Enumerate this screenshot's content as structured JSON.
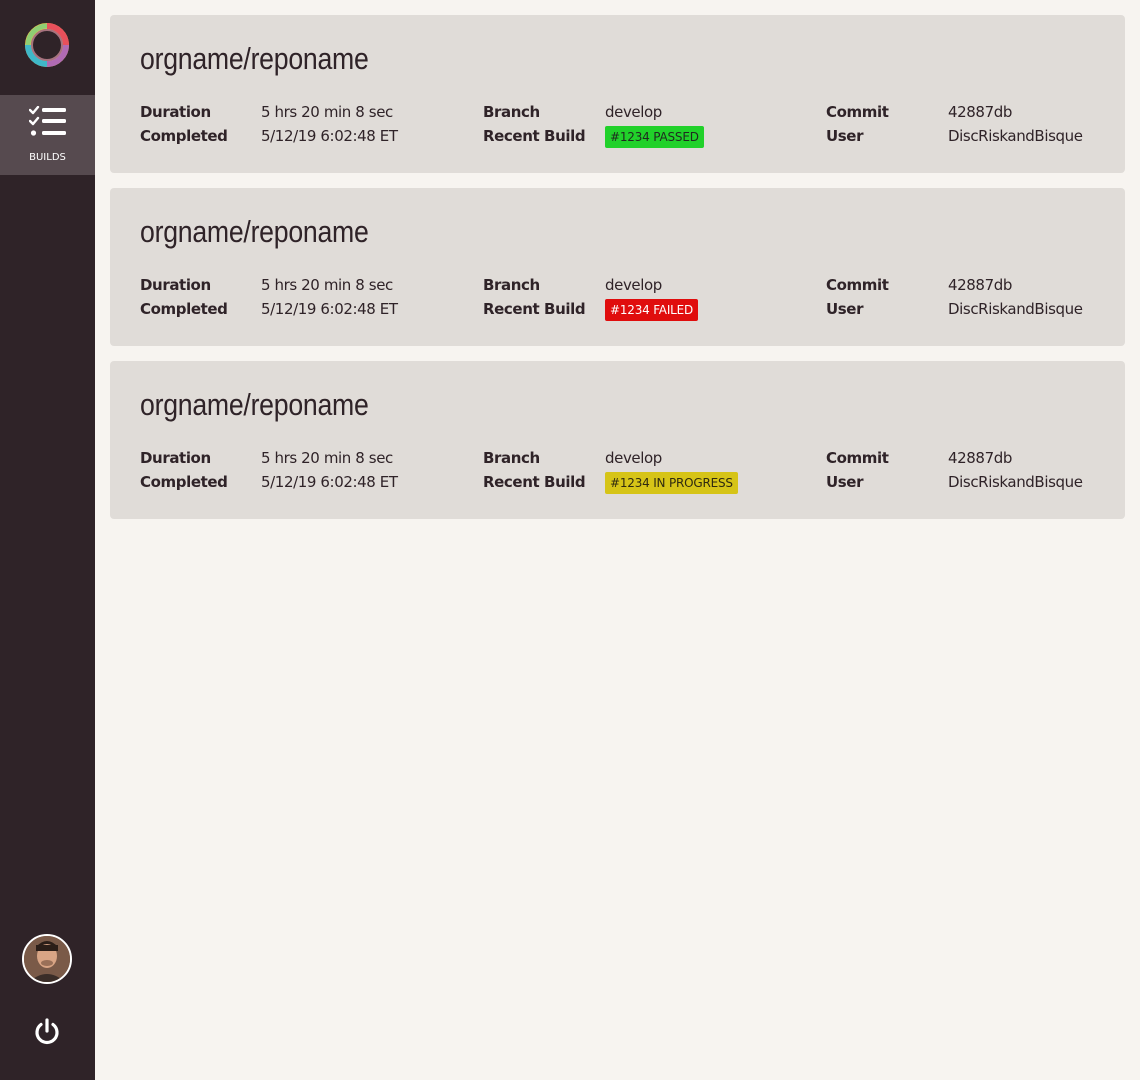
{
  "sidebar": {
    "nav_builds_label": "BUILDS"
  },
  "icons": {
    "logo": "ring-logo-icon",
    "builds": "checklist-icon",
    "avatar": "user-avatar",
    "power": "power-icon"
  },
  "colors": {
    "sidebar_bg": "#2f2328",
    "sidebar_active": "#564a4f",
    "card_bg": "#e0dcd8",
    "page_bg": "#f7f4f0",
    "passed": "#21d12a",
    "failed": "#e00d0d",
    "in_progress": "#d6c417"
  },
  "labels": {
    "duration": "Duration",
    "completed": "Completed",
    "branch": "Branch",
    "recent_build": "Recent Build",
    "commit": "Commit",
    "user": "User"
  },
  "builds": [
    {
      "repo": "orgname/reponame",
      "duration": "5 hrs 20 min 8 sec",
      "completed": "5/12/19 6:02:48 ET",
      "branch": "develop",
      "recent_build": "#1234 PASSED",
      "status": "passed",
      "commit": "42887db",
      "user": "DiscRiskandBisque"
    },
    {
      "repo": "orgname/reponame",
      "duration": "5 hrs 20 min 8 sec",
      "completed": "5/12/19 6:02:48 ET",
      "branch": "develop",
      "recent_build": "#1234 FAILED",
      "status": "failed",
      "commit": "42887db",
      "user": "DiscRiskandBisque"
    },
    {
      "repo": "orgname/reponame",
      "duration": "5 hrs 20 min 8 sec",
      "completed": "5/12/19 6:02:48 ET",
      "branch": "develop",
      "recent_build": "#1234 IN PROGRESS",
      "status": "in_progress",
      "commit": "42887db",
      "user": "DiscRiskandBisque"
    }
  ]
}
